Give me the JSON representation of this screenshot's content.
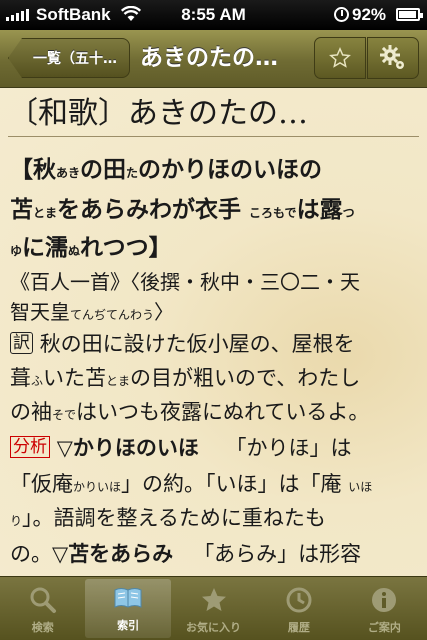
{
  "status_bar": {
    "carrier": "SoftBank",
    "time": "8:55 AM",
    "battery": "92%"
  },
  "nav": {
    "back_label": "一覧（五十…",
    "title": "あきのたの…",
    "star_icon": "star-icon",
    "gear_icon": "gear-icon"
  },
  "entry": {
    "heading": "〔和歌〕あきのたの…",
    "poem": {
      "l1_a": "【秋",
      "l1_r1": "あき",
      "l1_b": "の田",
      "l1_r2": "た",
      "l1_c": "のかりほのいほの",
      "l2_a": "苫",
      "l2_r1": "とま",
      "l2_b": "をあらみわが衣手",
      "l2_r2": "ころもで",
      "l2_c": "は露",
      "l2_r3": "つ",
      "l3_a": "ゆ",
      "l3_b": "に濡",
      "l3_r1": "ぬ",
      "l3_c": "れつつ】"
    },
    "source": {
      "l1": "《百人一首》〈後撰・秋中・三〇二・天",
      "l2_a": "智天皇",
      "l2_r": "てんぢてんわう",
      "l2_b": "〉"
    },
    "translation": {
      "tag": "訳",
      "l1": "秋の田に設けた仮小屋の、屋根を",
      "l2_a": "葺",
      "l2_r1": "ふ",
      "l2_b": "いた苫",
      "l2_r2": "とま",
      "l2_c": "の目が粗いので、わたし",
      "l3_a": "の袖",
      "l3_r": "そで",
      "l3_b": "はいつも夜露にぬれているよ。"
    },
    "analysis": {
      "tag": "分析",
      "l1_a": "▽かりほのいほ",
      "l1_b": "「かりほ」は",
      "l2_a": "「仮庵",
      "l2_r1": "かりいほ",
      "l2_b": "」の約。「いほ」は「庵",
      "l2_r2": "いほ",
      "l3_a": "り",
      "l3_b": "」。語調を整えるために重ねたも",
      "l4_a": "の。",
      "l4_b": "▽苫をあらみ",
      "l4_c": "「あらみ」は形容"
    }
  },
  "tabs": [
    {
      "label": "検索",
      "icon": "search-icon"
    },
    {
      "label": "索引",
      "icon": "book-icon"
    },
    {
      "label": "お気に入り",
      "icon": "star-icon"
    },
    {
      "label": "履歴",
      "icon": "history-icon"
    },
    {
      "label": "ご案内",
      "icon": "info-icon"
    }
  ],
  "colors": {
    "nav_olive": "#6f6b33",
    "paper": "#f4ebcf",
    "analysis_red": "#cc0000"
  }
}
